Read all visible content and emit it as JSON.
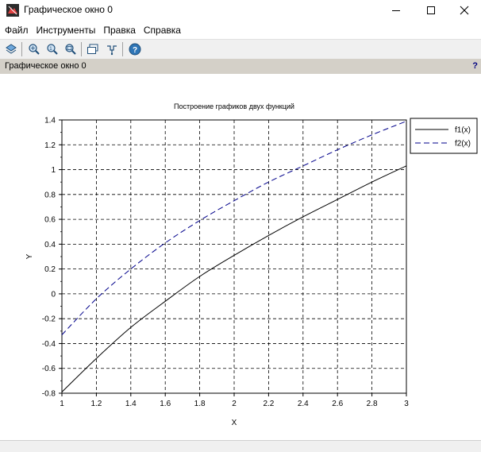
{
  "window": {
    "title": "Графическое окно 0",
    "minimize_icon": "minimize-icon",
    "maximize_icon": "maximize-icon",
    "close_icon": "close-icon"
  },
  "menu": {
    "items": [
      "Файл",
      "Инструменты",
      "Правка",
      "Справка"
    ]
  },
  "toolbar": {
    "icons": [
      "rotate-icon",
      "zoom-icon",
      "zoom-in-icon",
      "zoom-out-icon",
      "new-window-icon",
      "datatip-icon",
      "help-icon"
    ]
  },
  "infobar": {
    "title": "Графическое окно 0",
    "help_mark": "?"
  },
  "chart_data": {
    "type": "line",
    "title": "Построение графиков двух функций",
    "xlabel": "X",
    "ylabel": "Y",
    "xlim": [
      1,
      3
    ],
    "ylim": [
      -0.8,
      1.4
    ],
    "xticks": [
      "1",
      "1.2",
      "1.4",
      "1.6",
      "1.8",
      "2",
      "2.2",
      "2.4",
      "2.6",
      "2.8",
      "3"
    ],
    "yticks": [
      "-0.8",
      "-0.6",
      "-0.4",
      "-0.2",
      "0",
      "0.2",
      "0.4",
      "0.6",
      "0.8",
      "1",
      "1.2",
      "1.4"
    ],
    "grid": true,
    "legend_position": "top-right",
    "series": [
      {
        "name": "f1(x)",
        "style": "solid",
        "color": "#000000",
        "x": [
          1,
          1.2,
          1.4,
          1.6,
          1.8,
          2,
          2.2,
          2.4,
          2.6,
          2.8,
          3
        ],
        "y": [
          -0.79,
          -0.52,
          -0.27,
          -0.06,
          0.14,
          0.31,
          0.47,
          0.62,
          0.76,
          0.9,
          1.03
        ]
      },
      {
        "name": "f2(x)",
        "style": "dashed",
        "color": "#00008b",
        "x": [
          1,
          1.2,
          1.4,
          1.6,
          1.8,
          2,
          2.2,
          2.4,
          2.6,
          2.8,
          3
        ],
        "y": [
          -0.33,
          -0.04,
          0.2,
          0.41,
          0.59,
          0.75,
          0.9,
          1.03,
          1.16,
          1.28,
          1.39
        ]
      }
    ]
  }
}
